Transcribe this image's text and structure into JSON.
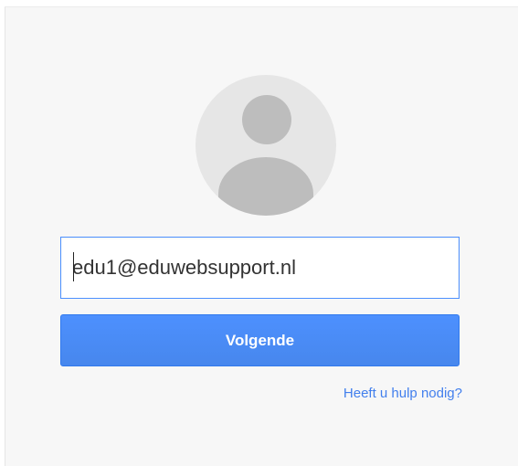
{
  "login": {
    "email_value": "edu1@eduwebsupport.nl",
    "next_label": "Volgende",
    "help_label": "Heeft u hulp nodig?"
  },
  "icons": {
    "avatar": "default-profile-avatar-icon"
  },
  "colors": {
    "accent": "#4d90fe",
    "link": "#427fed",
    "background": "#f7f7f7",
    "avatar_bg": "#e6e6e6",
    "avatar_fg": "#bdbdbd"
  }
}
